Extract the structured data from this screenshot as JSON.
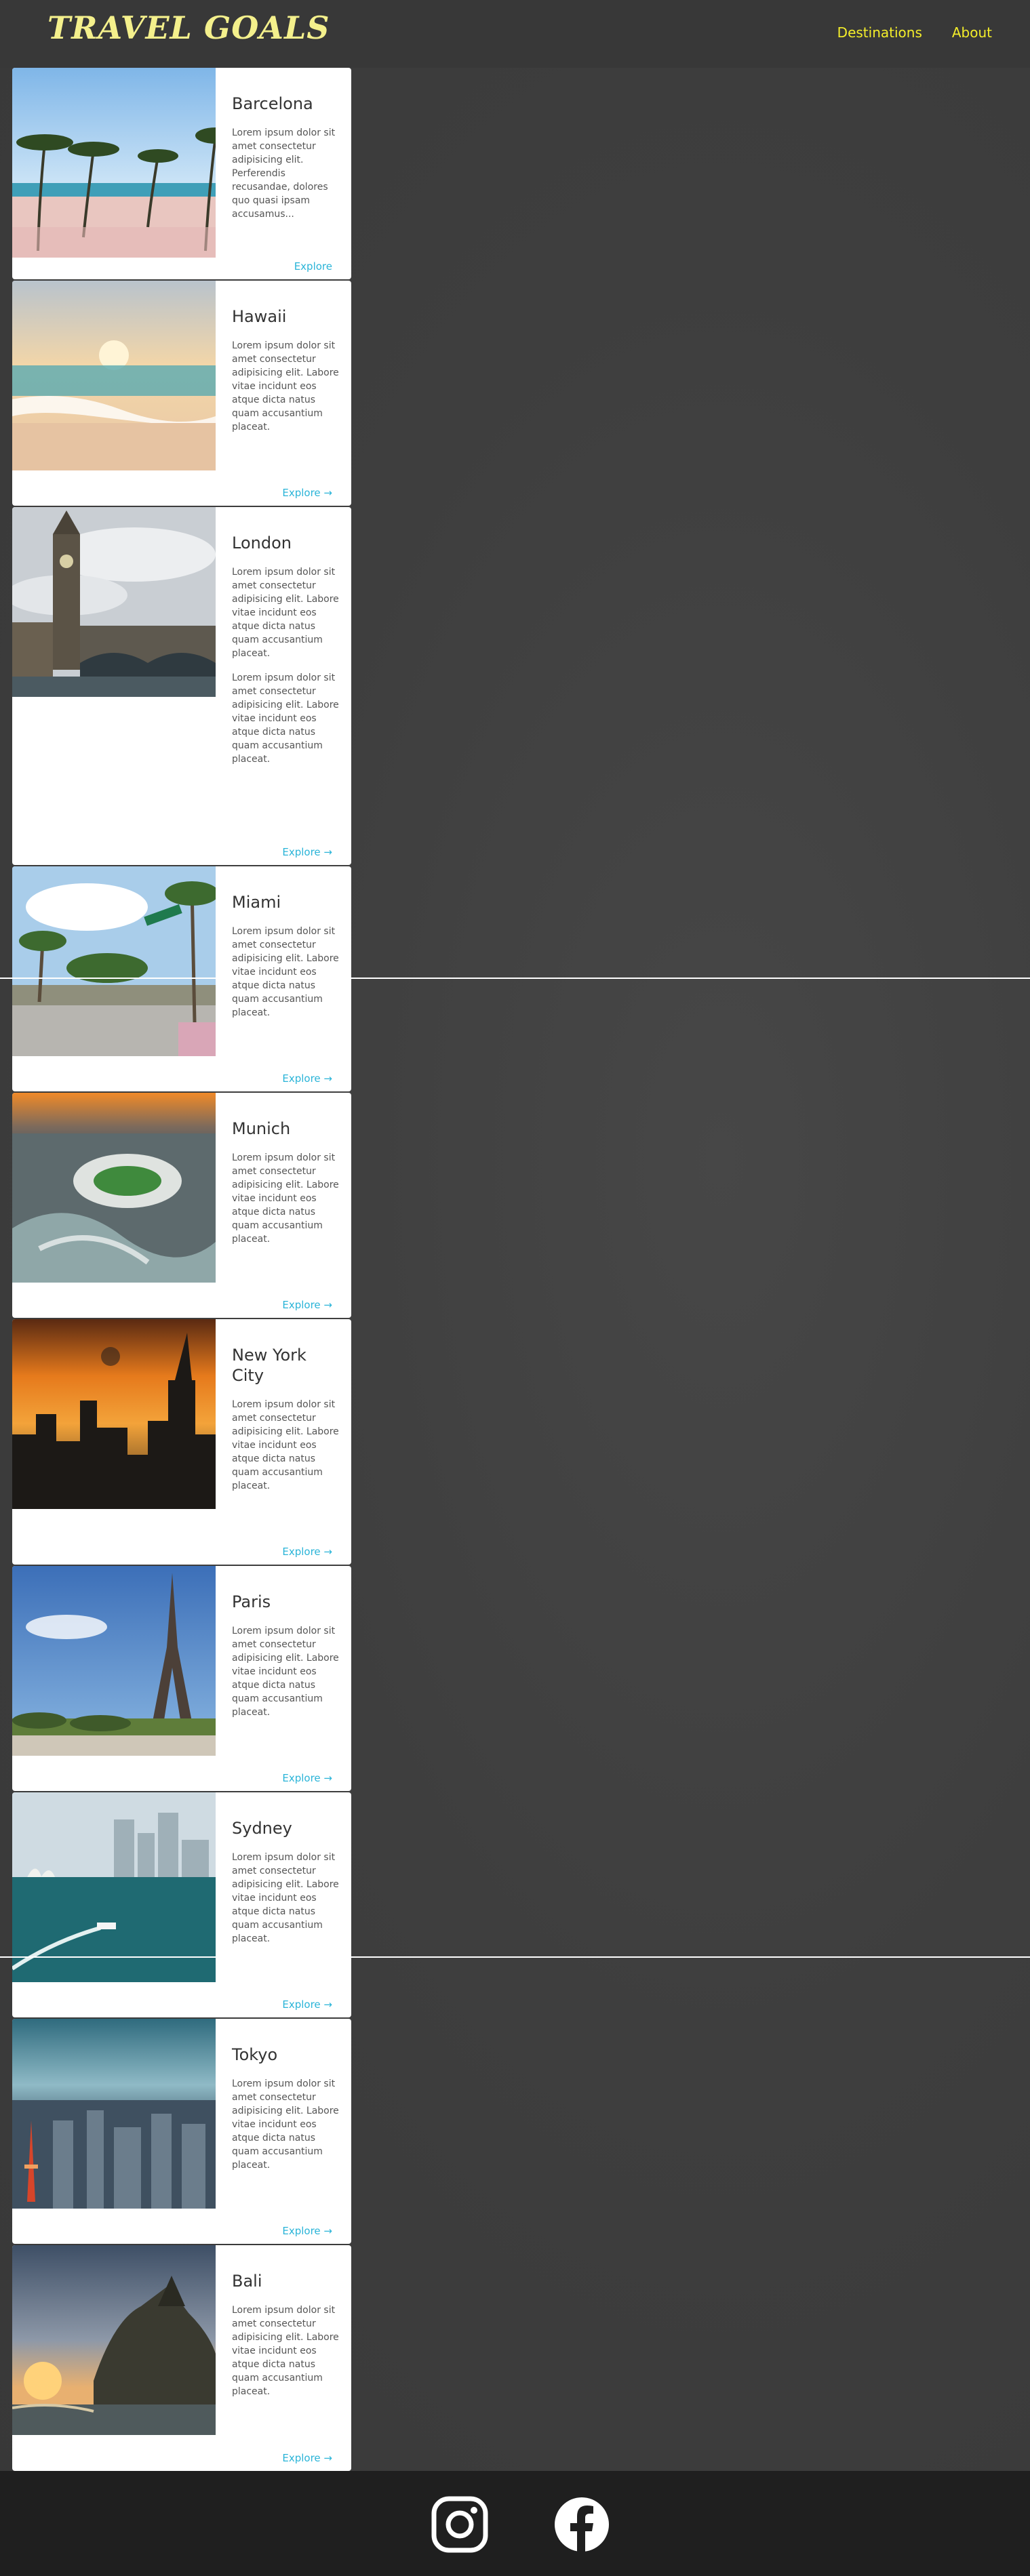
{
  "header": {
    "brand": "TRAVEL GOALS",
    "nav": [
      {
        "label": "Destinations"
      },
      {
        "label": "About"
      }
    ]
  },
  "cards": [
    {
      "title": "Barcelona",
      "text": "Lorem ipsum dolor sit amet consectetur adipisicing elit. Perferendis recusandae, dolores quo quasi ipsam accusamus...",
      "link": "Explore"
    },
    {
      "title": "Hawaii",
      "text": "Lorem ipsum dolor sit amet consectetur adipisicing elit. Labore vitae incidunt eos atque dicta natus quam accusantium placeat.",
      "link": "Explore →"
    },
    {
      "title": "London",
      "text": "Lorem ipsum dolor sit amet consectetur adipisicing elit. Labore vitae incidunt eos atque dicta natus quam accusantium placeat.",
      "text2": "Lorem ipsum dolor sit amet consectetur adipisicing elit. Labore vitae incidunt eos atque dicta natus quam accusantium placeat.",
      "link": "Explore →"
    },
    {
      "title": "Miami",
      "text": "Lorem ipsum dolor sit amet consectetur adipisicing elit. Labore vitae incidunt eos atque dicta natus quam accusantium placeat.",
      "link": "Explore →"
    },
    {
      "title": "Munich",
      "text": "Lorem ipsum dolor sit amet consectetur adipisicing elit. Labore vitae incidunt eos atque dicta natus quam accusantium placeat.",
      "link": "Explore →"
    },
    {
      "title": "New York City",
      "text": "Lorem ipsum dolor sit amet consectetur adipisicing elit. Labore vitae incidunt eos atque dicta natus quam accusantium placeat.",
      "link": "Explore →"
    },
    {
      "title": "Paris",
      "text": "Lorem ipsum dolor sit amet consectetur adipisicing elit. Labore vitae incidunt eos atque dicta natus quam accusantium placeat.",
      "link": "Explore →"
    },
    {
      "title": "Sydney",
      "text": "Lorem ipsum dolor sit amet consectetur adipisicing elit. Labore vitae incidunt eos atque dicta natus quam accusantium placeat.",
      "link": "Explore →"
    },
    {
      "title": "Tokyo",
      "text": "Lorem ipsum dolor sit amet consectetur adipisicing elit. Labore vitae incidunt eos atque dicta natus quam accusantium placeat.",
      "link": "Explore →"
    },
    {
      "title": "Bali",
      "text": "Lorem ipsum dolor sit amet consectetur adipisicing elit. Labore vitae incidunt eos atque dicta natus quam accusantium placeat.",
      "link": "Explore →"
    }
  ],
  "footer": {
    "icons": [
      "instagram-icon",
      "facebook-icon"
    ]
  },
  "colors": {
    "brand": "#f4f08c",
    "nav_link": "#f4ee2a",
    "explore_link": "#2ab4d8",
    "footer_bg": "#1f1f1f"
  }
}
